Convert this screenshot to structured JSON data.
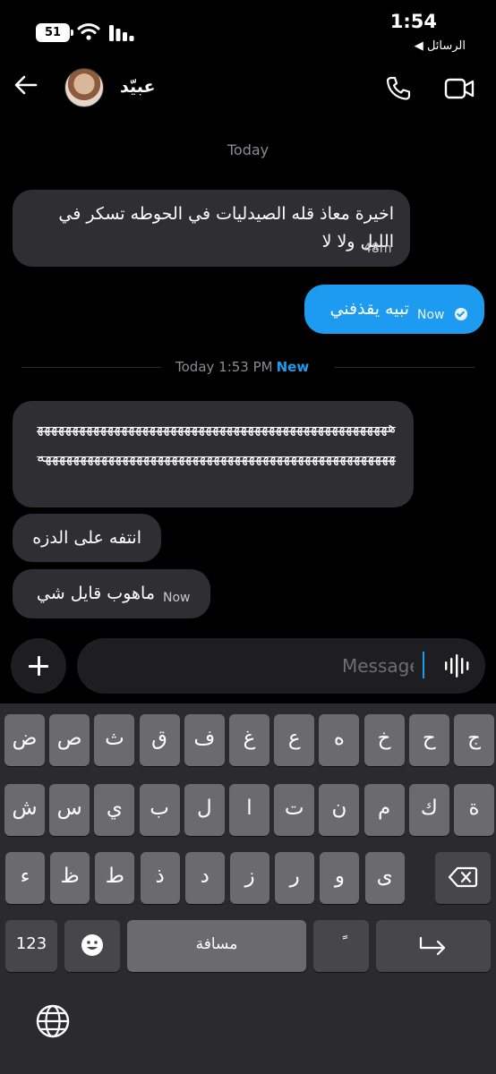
{
  "status_bar": {
    "time": "1:54",
    "back_label": "◀ الرسائل",
    "battery": "51"
  },
  "header": {
    "contact_name": "عبيّد"
  },
  "thread": {
    "day_label": "Today",
    "divider_text": "Today 1:53 PM",
    "divider_new": "New",
    "messages": [
      {
        "text": "اخيرة معاذ قله الصيدليات في الحوطه تسكر في الليل ولا لا",
        "time": "48m",
        "from": "contact"
      },
      {
        "text": "تبيه يقذفني",
        "time": "Now",
        "from": "me",
        "status": "read"
      },
      {
        "text": "هههههههههههههههههههههههههههههههههههههههههههههههههههههههههههههههههههههههههههههههههههههههههههههههههههههه",
        "from": "contact"
      },
      {
        "text": "انتفه على الدزه",
        "from": "contact"
      },
      {
        "text": "ماهوب قايل شي",
        "time": "Now",
        "from": "contact"
      }
    ]
  },
  "composer": {
    "placeholder": "Message",
    "value": ""
  },
  "keyboard": {
    "row1": [
      "ض",
      "ص",
      "ث",
      "ق",
      "ف",
      "غ",
      "ع",
      "ه",
      "خ",
      "ح",
      "ج"
    ],
    "row2": [
      "ش",
      "س",
      "ي",
      "ب",
      "ل",
      "ا",
      "ت",
      "ن",
      "م",
      "ك",
      "ة"
    ],
    "row3": [
      "ء",
      "ظ",
      "ط",
      "ذ",
      "د",
      "ز",
      "ر",
      "و",
      "ى"
    ],
    "numbers_label": "123",
    "space_label": "مسافة",
    "tanween_label": "ً"
  }
}
